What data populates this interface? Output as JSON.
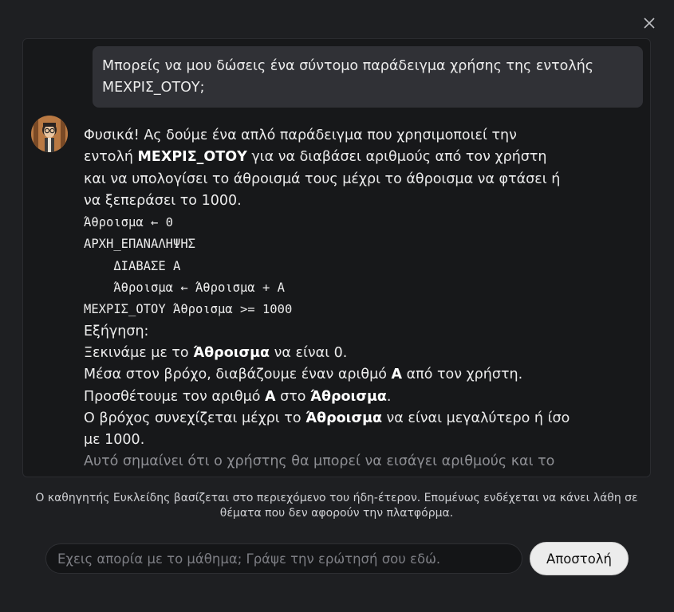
{
  "user_message": "Μπορείς να μου δώσεις ένα σύντομο παράδειγμα χρήσης της εντολής ΜΕΧΡΙΣ_ΟΤΟΥ;",
  "assistant": {
    "intro_1": "Φυσικά! Ας δούμε ένα απλό παράδειγμα που χρησιμοποιεί την εντολή ",
    "intro_bold": "ΜΕΧΡΙΣ_ΟΤΟΥ",
    "intro_2": " για να διαβάσει αριθμούς από τον χρήστη και να υπολογίσει το άθροισμά τους μέχρι το άθροισμα να φτάσει ή να ξεπεράσει το 1000.",
    "code": [
      "Άθροισμα ← 0",
      "ΑΡΧΗ_ΕΠΑΝΑΛΗΨΗΣ",
      "    ΔΙΑΒΑΣΕ Α",
      "    Άθροισμα ← Άθροισμα + Α",
      "ΜΕΧΡΙΣ_ΟΤΟΥ Άθροισμα >= 1000"
    ],
    "explanation_heading": "Εξήγηση:",
    "l1_a": "Ξεκινάμε με το ",
    "l1_b": "Άθροισμα",
    "l1_c": " να είναι 0.",
    "l2_a": "Μέσα στον βρόχο, διαβάζουμε έναν αριθμό ",
    "l2_b": "Α",
    "l2_c": " από τον χρήστη.",
    "l3_a": "Προσθέτουμε τον αριθμό ",
    "l3_b": "Α",
    "l3_c": " στο ",
    "l3_d": "Άθροισμα",
    "l3_e": ".",
    "l4_a": "Ο βρόχος συνεχίζεται μέχρι το ",
    "l4_b": "Άθροισμα",
    "l4_c": " να είναι μεγαλύτερο ή ίσο με 1000.",
    "l5": "Αυτό σημαίνει ότι ο χρήστης θα μπορεί να εισάγει αριθμούς και το"
  },
  "disclaimer": "Ο καθηγητής Ευκλείδης βασίζεται στο περιεχόμενο του ήδη-έτερον. Επομένως ενδέχεται να κάνει λάθη σε θέματα που δεν αφορούν την πλατφόρμα.",
  "input": {
    "placeholder": "Εχεις απορία με το μάθημα; Γράψε την ερώτησή σου εδώ.",
    "value": ""
  },
  "send_label": "Αποστολή",
  "icons": {
    "close": "close-icon",
    "avatar": "avatar-image"
  }
}
